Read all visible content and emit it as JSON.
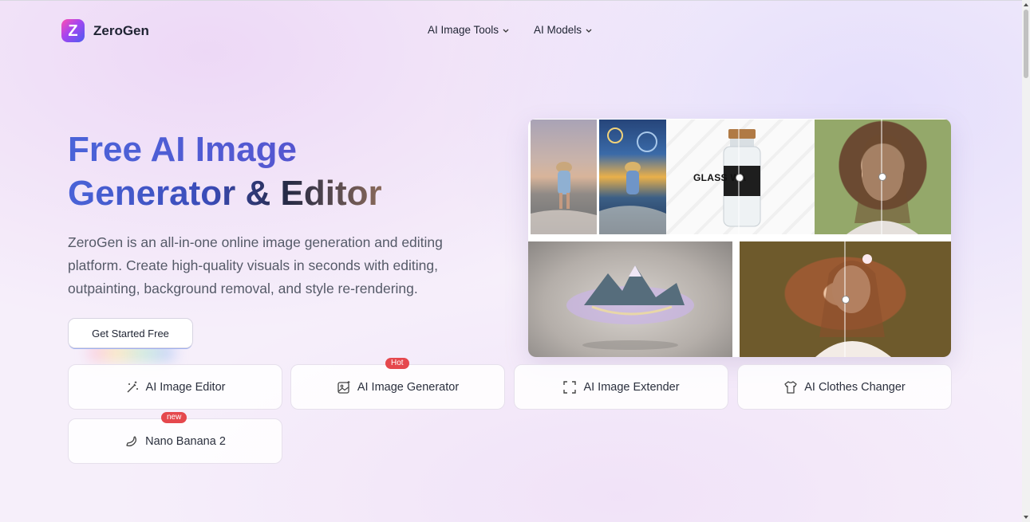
{
  "brand": {
    "name": "ZeroGen",
    "logo_letter": "Z"
  },
  "nav": [
    {
      "label": "AI Image Tools"
    },
    {
      "label": "AI Models"
    }
  ],
  "hero": {
    "title_line1_a": "Free AI Image",
    "title_line2_a": "Generator",
    "title_line2_b": " & Editor",
    "description": "ZeroGen is an all-in-one online image generation and editing platform. Create high-quality visuals in seconds with editing, outpainting, background removal, and style re-rendering.",
    "cta_label": "Get Started Free"
  },
  "showcase": {
    "bottle_text": "GLASS WA"
  },
  "tools": [
    {
      "label": "AI Image Editor",
      "icon": "magic-wand-icon",
      "badge": ""
    },
    {
      "label": "AI Image Generator",
      "icon": "image-sparkle-icon",
      "badge": "Hot"
    },
    {
      "label": "AI Image Extender",
      "icon": "expand-frame-icon",
      "badge": ""
    },
    {
      "label": "AI Clothes Changer",
      "icon": "shirt-icon",
      "badge": ""
    },
    {
      "label": "Nano Banana 2",
      "icon": "banana-icon",
      "badge": "new"
    }
  ],
  "colors": {
    "brand_gradient_start": "#ff4fb0",
    "brand_gradient_end": "#4b5cf0",
    "title_blue": "#4a63d8",
    "badge_red": "#e5484d"
  }
}
